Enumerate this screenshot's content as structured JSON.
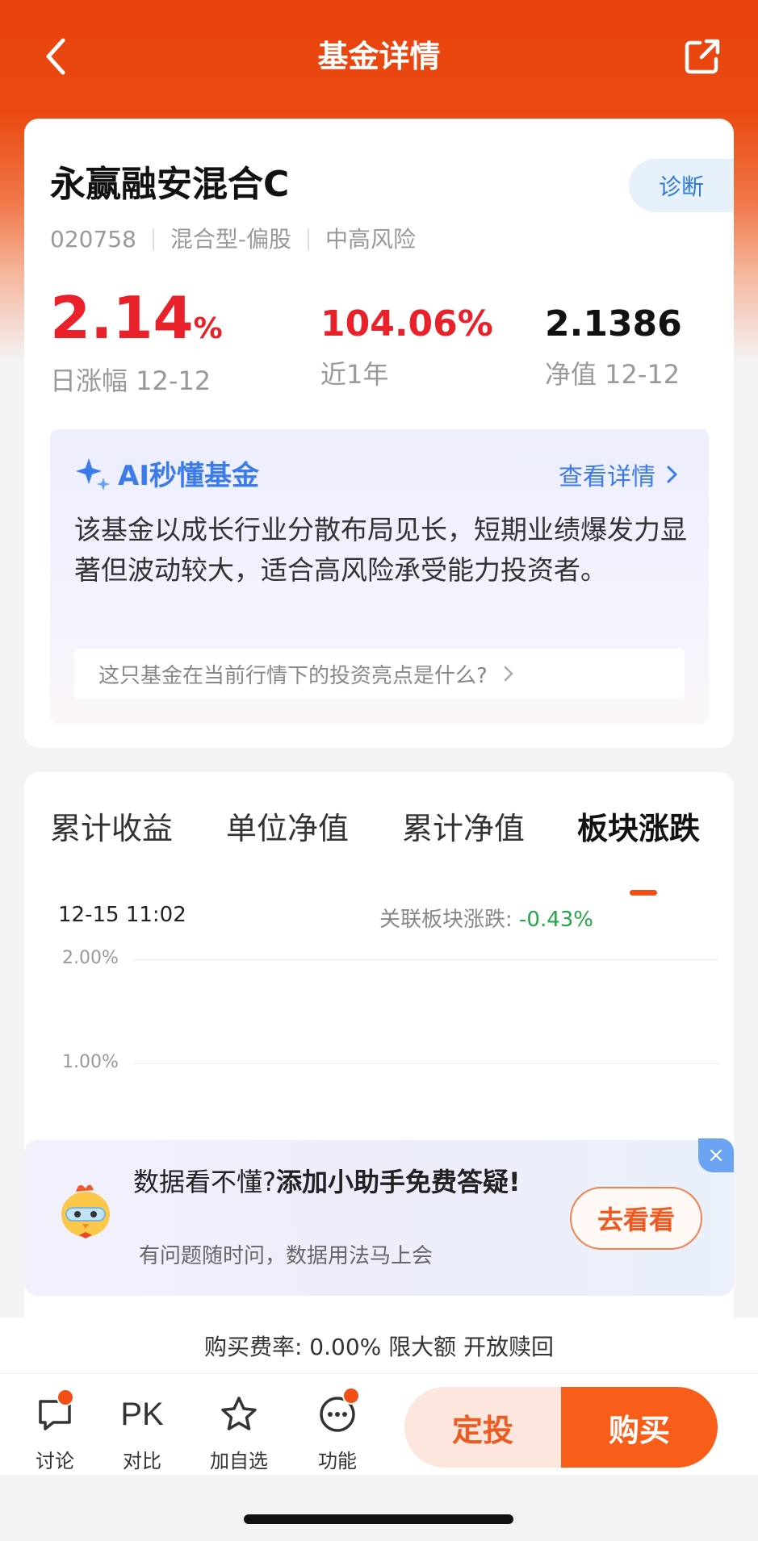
{
  "header": {
    "title": "基金详情"
  },
  "fund": {
    "name": "永赢融安混合C",
    "diagnose_label": "诊断",
    "code": "020758",
    "type": "混合型-偏股",
    "risk": "中高风险",
    "daily_change": "2.14",
    "daily_change_unit": "%",
    "daily_change_label": "日涨幅 12-12",
    "year_return": "104.06%",
    "year_return_label": "近1年",
    "nav": "2.1386",
    "nav_label": "净值 12-12"
  },
  "ai": {
    "title": "AI秒懂基金",
    "more": "查看详情",
    "summary": "该基金以成长行业分散布局见长，短期业绩爆发力显著但波动较大，适合高风险承受能力投资者。",
    "question": "这只基金在当前行情下的投资亮点是什么?"
  },
  "tabs": [
    {
      "label": "累计收益"
    },
    {
      "label": "单位净值"
    },
    {
      "label": "累计净值"
    },
    {
      "label": "板块涨跌"
    }
  ],
  "chart": {
    "time": "12-15 11:02",
    "sector_label": "关联板块涨跌: ",
    "sector_value": "-0.43%",
    "sector_color": "#22a848",
    "y_ticks": [
      "2.00%",
      "1.00%"
    ]
  },
  "promo": {
    "title_plain": "数据看不懂?",
    "title_bold": "添加小助手免费答疑!",
    "subtitle": "有问题随时问，数据用法马上会",
    "button": "去看看",
    "close": "×"
  },
  "fee": {
    "text": "购买费率: 0.00% 限大额 开放赎回"
  },
  "bottom_nav": {
    "discuss": "讨论",
    "pk_icon_text": "PK",
    "compare": "对比",
    "watchlist": "加自选",
    "functions": "功能",
    "sip_button": "定投",
    "buy_button": "购买"
  },
  "colors": {
    "accent": "#e9420d",
    "rise": "#e8212a",
    "fall": "#22a848",
    "ai_blue": "#3b7bea",
    "buy": "#f85d1a"
  }
}
